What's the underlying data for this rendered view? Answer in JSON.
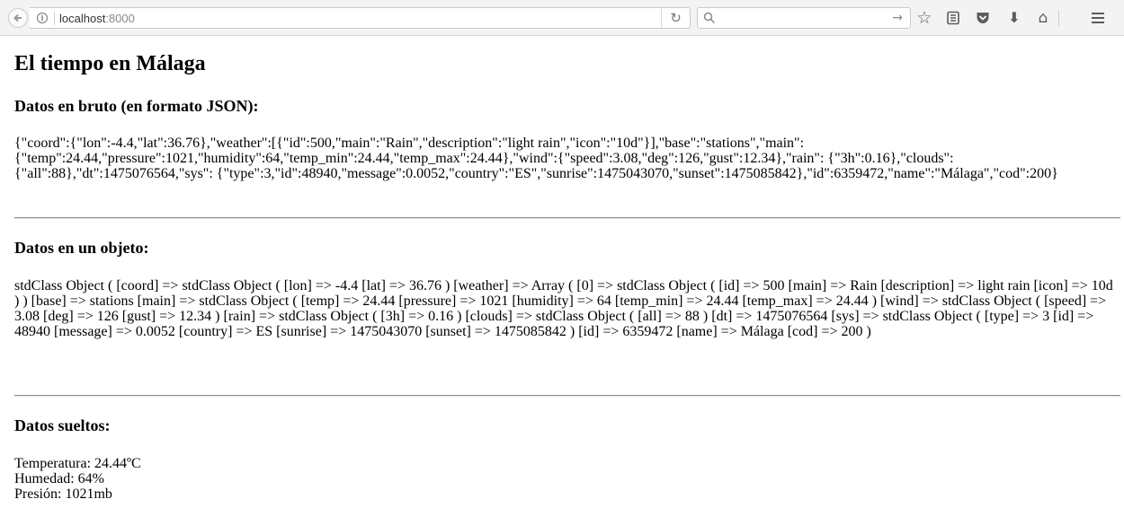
{
  "browser": {
    "url_host": "localhost",
    "url_port": ":8000",
    "icons": [
      "back-arrow-icon",
      "info-icon",
      "reload-icon",
      "search-icon",
      "go-arrow-icon",
      "bookmark-star-icon",
      "reading-list-icon",
      "pocket-icon",
      "download-icon",
      "home-icon",
      "hamburger-menu-icon"
    ]
  },
  "page": {
    "title": "El tiempo en Málaga",
    "raw_heading": "Datos en bruto (en formato JSON):",
    "raw_text": "{\"coord\":{\"lon\":-4.4,\"lat\":36.76},\"weather\":[{\"id\":500,\"main\":\"Rain\",\"description\":\"light rain\",\"icon\":\"10d\"}],\"base\":\"stations\",\"main\": {\"temp\":24.44,\"pressure\":1021,\"humidity\":64,\"temp_min\":24.44,\"temp_max\":24.44},\"wind\":{\"speed\":3.08,\"deg\":126,\"gust\":12.34},\"rain\": {\"3h\":0.16},\"clouds\":{\"all\":88},\"dt\":1475076564,\"sys\": {\"type\":3,\"id\":48940,\"message\":0.0052,\"country\":\"ES\",\"sunrise\":1475043070,\"sunset\":1475085842},\"id\":6359472,\"name\":\"Málaga\",\"cod\":200}",
    "object_heading": "Datos en un objeto:",
    "object_text": "stdClass Object ( [coord] => stdClass Object ( [lon] => -4.4 [lat] => 36.76 ) [weather] => Array ( [0] => stdClass Object ( [id] => 500 [main] => Rain [description] => light rain [icon] => 10d ) ) [base] => stations [main] => stdClass Object ( [temp] => 24.44 [pressure] => 1021 [humidity] => 64 [temp_min] => 24.44 [temp_max] => 24.44 ) [wind] => stdClass Object ( [speed] => 3.08 [deg] => 126 [gust] => 12.34 ) [rain] => stdClass Object ( [3h] => 0.16 ) [clouds] => stdClass Object ( [all] => 88 ) [dt] => 1475076564 [sys] => stdClass Object ( [type] => 3 [id] => 48940 [message] => 0.0052 [country] => ES [sunrise] => 1475043070 [sunset] => 1475085842 ) [id] => 6359472 [name] => Málaga [cod] => 200 )",
    "loose_heading": "Datos sueltos:",
    "temperature": "Temperatura: 24.44ºC",
    "humidity": "Humedad: 64%",
    "pressure": "Presión: 1021mb"
  }
}
